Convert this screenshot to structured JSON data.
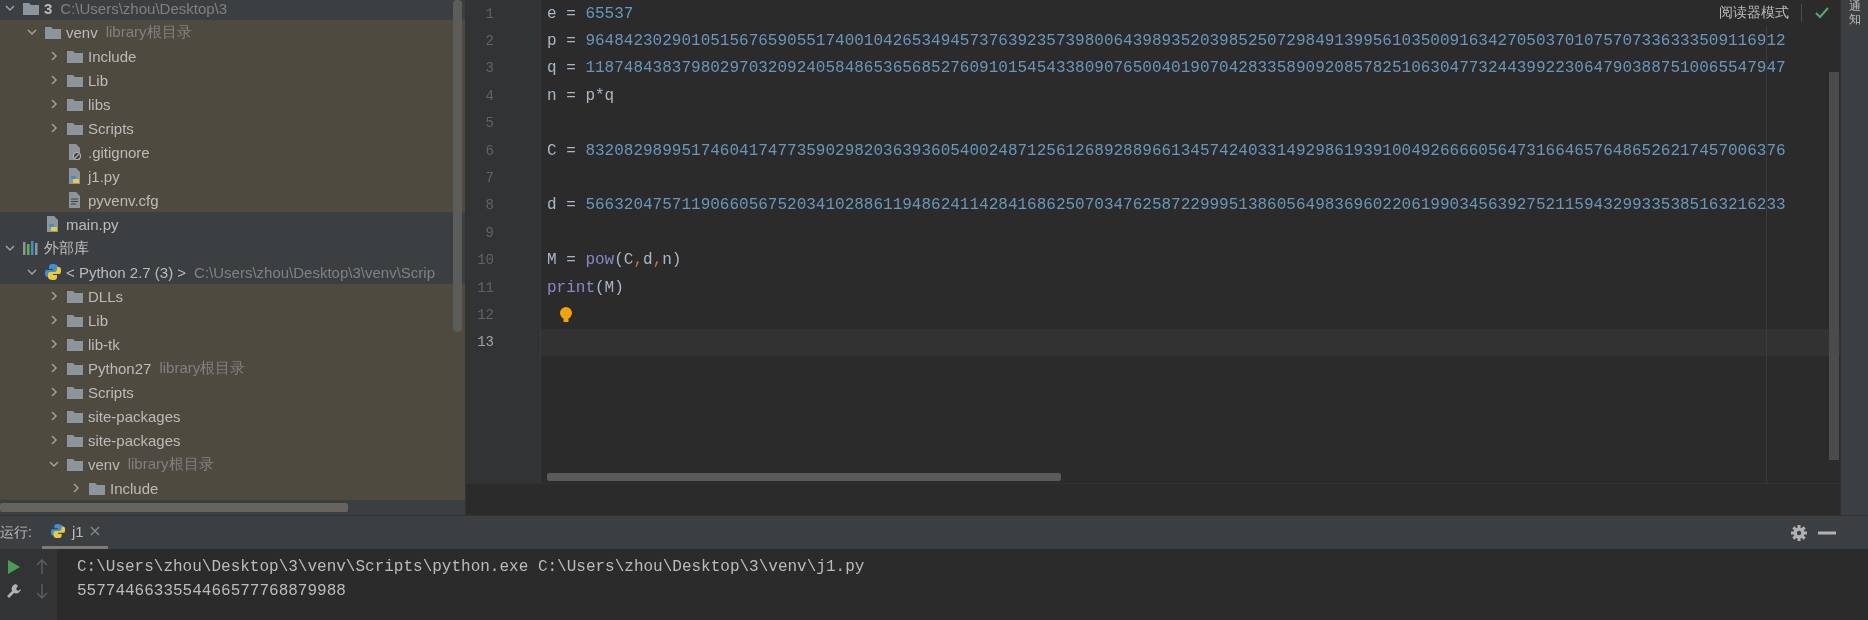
{
  "project_tree": {
    "items": [
      {
        "kind": "folder",
        "label": "3",
        "bold": true,
        "note": "C:\\Users\\zhou\\Desktop\\3",
        "expanded": true,
        "shaded": false,
        "children": [
          {
            "kind": "folder",
            "label": "venv",
            "note": "library根目录",
            "expanded": true,
            "shaded": true,
            "children": [
              {
                "kind": "folder",
                "label": "Include",
                "expanded": false,
                "shaded": true
              },
              {
                "kind": "folder",
                "label": "Lib",
                "expanded": false,
                "shaded": true
              },
              {
                "kind": "folder",
                "label": "libs",
                "expanded": false,
                "shaded": true
              },
              {
                "kind": "folder",
                "label": "Scripts",
                "expanded": false,
                "shaded": true
              },
              {
                "kind": "ignore-file",
                "label": ".gitignore",
                "shaded": true
              },
              {
                "kind": "python-file",
                "label": "j1.py",
                "shaded": true
              },
              {
                "kind": "text-file",
                "label": "pyvenv.cfg",
                "shaded": true
              }
            ]
          },
          {
            "kind": "python-file",
            "label": "main.py",
            "shaded": false
          }
        ]
      },
      {
        "kind": "library",
        "label": "外部库",
        "expanded": true,
        "shaded": false,
        "children": [
          {
            "kind": "sdk",
            "label": "< Python 2.7 (3) >",
            "note": "C:\\Users\\zhou\\Desktop\\3\\venv\\Scrip",
            "expanded": true,
            "shaded": false,
            "children": [
              {
                "kind": "folder",
                "label": "DLLs",
                "expanded": false,
                "shaded": true
              },
              {
                "kind": "folder",
                "label": "Lib",
                "expanded": false,
                "shaded": true
              },
              {
                "kind": "folder",
                "label": "lib-tk",
                "expanded": false,
                "shaded": true
              },
              {
                "kind": "folder",
                "label": "Python27",
                "note": "library根目录",
                "expanded": false,
                "shaded": true
              },
              {
                "kind": "folder",
                "label": "Scripts",
                "expanded": false,
                "shaded": true
              },
              {
                "kind": "folder",
                "label": "site-packages",
                "expanded": false,
                "shaded": true
              },
              {
                "kind": "folder",
                "label": "site-packages",
                "expanded": false,
                "shaded": true
              },
              {
                "kind": "folder",
                "label": "venv",
                "note": "library根目录",
                "expanded": true,
                "shaded": true,
                "children": [
                  {
                    "kind": "folder",
                    "label": "Include",
                    "expanded": false,
                    "shaded": true
                  }
                ]
              }
            ]
          }
        ]
      }
    ]
  },
  "editor": {
    "reader_mode": "阅读器模式",
    "lines": [
      {
        "number": "1",
        "current": false,
        "tokens": [
          {
            "kind": "plain",
            "text": "e = "
          },
          {
            "kind": "number",
            "text": "65537"
          }
        ]
      },
      {
        "number": "2",
        "current": false,
        "tokens": [
          {
            "kind": "plain",
            "text": "p = "
          },
          {
            "kind": "number",
            "text": "96484230290105156765905517400104265349457376392357398006439893520398525072984913995610350091634270503701075707336333509116912"
          }
        ]
      },
      {
        "number": "3",
        "current": false,
        "tokens": [
          {
            "kind": "plain",
            "text": "q = "
          },
          {
            "kind": "number",
            "text": "11874843837980297032092405848653656852760910154543380907650040190704283358909208578251063047732443992230647903887510065547947"
          }
        ]
      },
      {
        "number": "4",
        "current": false,
        "tokens": [
          {
            "kind": "plain",
            "text": "n = p*q"
          }
        ]
      },
      {
        "number": "5",
        "current": false
      },
      {
        "number": "6",
        "current": false,
        "tokens": [
          {
            "kind": "plain",
            "text": "C = "
          },
          {
            "kind": "number",
            "text": "83208298995174604174773590298203639360540024871256126892889661345742403314929861939100492666605647316646576486526217457006376"
          }
        ]
      },
      {
        "number": "7",
        "current": false
      },
      {
        "number": "8",
        "current": false,
        "tokens": [
          {
            "kind": "plain",
            "text": "d = "
          },
          {
            "kind": "number",
            "text": "56632047571190660567520341028861194862411428416862507034762587229995138605649836960220619903456392752115943299335385163216233"
          }
        ]
      },
      {
        "number": "9",
        "current": false
      },
      {
        "number": "10",
        "current": false,
        "tokens": [
          {
            "kind": "plain",
            "text": "M = "
          },
          {
            "kind": "builtin",
            "text": "pow"
          },
          {
            "kind": "plain",
            "text": "(C"
          },
          {
            "kind": "punct",
            "text": ","
          },
          {
            "kind": "plain",
            "text": "d"
          },
          {
            "kind": "punct",
            "text": ","
          },
          {
            "kind": "plain",
            "text": "n)"
          }
        ]
      },
      {
        "number": "11",
        "current": false,
        "tokens": [
          {
            "kind": "builtin",
            "text": "print"
          },
          {
            "kind": "plain",
            "text": "(M)"
          }
        ]
      },
      {
        "number": "12",
        "current": false,
        "hint": true
      },
      {
        "number": "13",
        "current": true
      }
    ]
  },
  "right_strip": {
    "label": "通知"
  },
  "run_panel": {
    "label": "运行:",
    "tabs": [
      {
        "label": "j1",
        "selected": true
      }
    ],
    "toolbar": [
      {
        "kind": "run",
        "disabled": false
      },
      {
        "kind": "up",
        "disabled": true
      },
      {
        "kind": "wrench",
        "disabled": false
      },
      {
        "kind": "down",
        "disabled": true
      }
    ],
    "output": [
      "C:\\Users\\zhou\\Desktop\\3\\venv\\Scripts\\python.exe C:\\Users\\zhou\\Desktop\\3\\venv\\j1.py",
      "5577446633554466577768879988"
    ]
  }
}
